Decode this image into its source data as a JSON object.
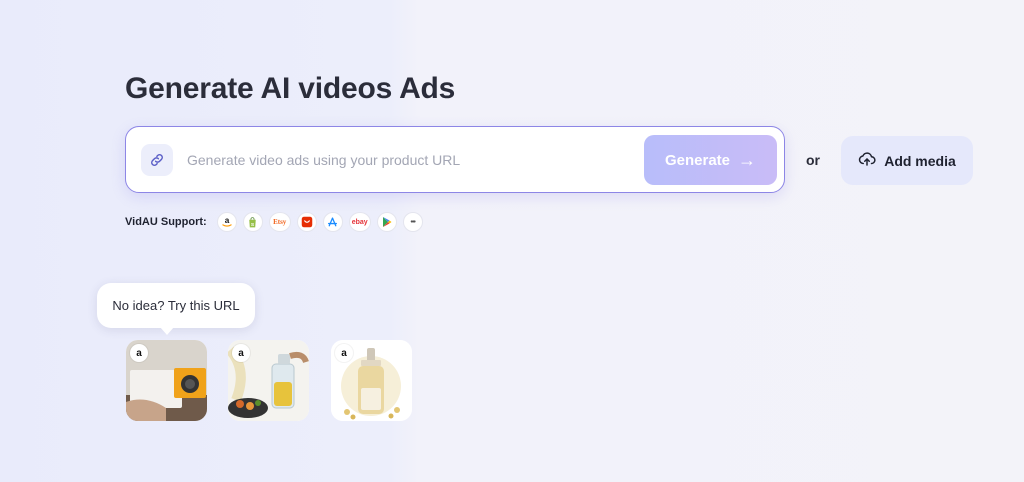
{
  "header": {
    "title": "Generate AI videos Ads"
  },
  "search": {
    "placeholder": "Generate video ads using your product URL",
    "value": "",
    "generate_label": "Generate",
    "generate_arrow": "→"
  },
  "or_text": "or",
  "add_media": {
    "label": "Add media"
  },
  "support": {
    "label": "VidAU Support:",
    "platforms": [
      {
        "name": "amazon",
        "glyph": "a",
        "color": "#111111"
      },
      {
        "name": "shopify",
        "glyph": "",
        "color": "#95bf47"
      },
      {
        "name": "etsy",
        "glyph": "Etsy",
        "color": "#f1641e"
      },
      {
        "name": "aliexpress",
        "glyph": "",
        "color": "#e62e04"
      },
      {
        "name": "app-store",
        "glyph": "",
        "color": "#1a8cff"
      },
      {
        "name": "ebay",
        "glyph": "ebay",
        "color": "#e53238"
      },
      {
        "name": "google-play",
        "glyph": "",
        "color": "#34a853"
      },
      {
        "name": "more",
        "glyph": "•••",
        "color": "#555555"
      }
    ]
  },
  "tooltip": {
    "text": "No idea? Try this URL"
  },
  "samples": [
    {
      "name": "sample-projector",
      "badge": "a"
    },
    {
      "name": "sample-oil-sprayer",
      "badge": "a"
    },
    {
      "name": "sample-serum-bottle",
      "badge": "a"
    }
  ],
  "colors": {
    "accent": "#8d86e6",
    "generate_bg": "#b8bdfa",
    "add_media_bg": "#e5e8fb"
  }
}
